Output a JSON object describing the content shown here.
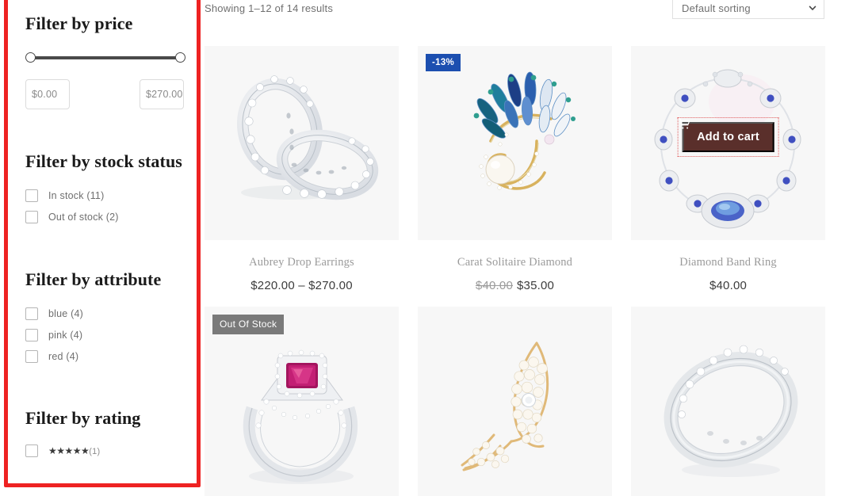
{
  "sidebar": {
    "price_filter": {
      "title": "Filter by price",
      "min_value": "$0.00",
      "max_value": "$270.00"
    },
    "stock_filter": {
      "title": "Filter by stock status",
      "options": [
        {
          "label": "In stock (11)"
        },
        {
          "label": "Out of stock (2)"
        }
      ]
    },
    "attribute_filter": {
      "title": "Filter by attribute",
      "options": [
        {
          "label": "blue (4)"
        },
        {
          "label": "pink (4)"
        },
        {
          "label": "red (4)"
        }
      ]
    },
    "rating_filter": {
      "title": "Filter by rating",
      "options": [
        {
          "stars": "★★★★★",
          "count": "(1)"
        }
      ]
    }
  },
  "main": {
    "result_count": "Showing 1–12 of 14 results",
    "sorting": {
      "selected": "Default sorting",
      "icon": "chevron-down-icon"
    },
    "products": [
      {
        "title": "Aubrey Drop Earrings",
        "price": "$220.00 – $270.00",
        "old_price": "",
        "badge": "",
        "badge_type": "",
        "add_to_cart": ""
      },
      {
        "title": "Carat Solitaire Diamond",
        "price": "$35.00",
        "old_price": "$40.00",
        "badge": "-13%",
        "badge_type": "sale",
        "add_to_cart": ""
      },
      {
        "title": "Diamond Band Ring",
        "price": "$40.00",
        "old_price": "",
        "badge": "",
        "badge_type": "",
        "add_to_cart": "Add to cart"
      },
      {
        "title": "",
        "price": "",
        "old_price": "",
        "badge": "Out Of Stock",
        "badge_type": "oos",
        "add_to_cart": ""
      },
      {
        "title": "",
        "price": "",
        "old_price": "",
        "badge": "",
        "badge_type": "",
        "add_to_cart": ""
      },
      {
        "title": "",
        "price": "",
        "old_price": "",
        "badge": "",
        "badge_type": "",
        "add_to_cart": ""
      }
    ]
  },
  "colors": {
    "sale_badge": "#1c4fb0",
    "oos_badge": "#7a7a7a",
    "add_to_cart": "#5a2f2b",
    "highlight": "#ee2222"
  }
}
